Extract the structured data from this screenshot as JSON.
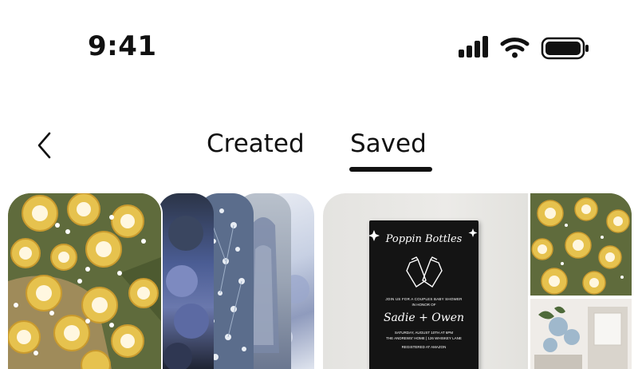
{
  "status_bar": {
    "time": "9:41",
    "icons": [
      "cellular-signal-icon",
      "wifi-icon",
      "battery-icon"
    ]
  },
  "nav": {
    "back_icon": "chevron-left-icon",
    "tabs": [
      {
        "label": "Created",
        "active": false
      },
      {
        "label": "Saved",
        "active": true
      }
    ]
  },
  "boards": [
    {
      "name": "board-collage-left",
      "images": [
        "lemon-gypsophila-photo",
        "blue-flowers-photo",
        "babys-breath-photo",
        "blue-vase-photo",
        "light-blue-decor-photo"
      ]
    },
    {
      "name": "board-collage-right",
      "images": [
        "invitation-card-photo",
        "lemon-gypsophila-photo",
        "baby-shower-decor-photo"
      ],
      "invitation": {
        "title": "Poppin Bottles",
        "line1": "JOIN US FOR A COUPLES BABY SHOWER",
        "line2": "IN HONOR OF",
        "names": "Sadie + Owen",
        "line3": "SATURDAY, AUGUST 10TH AT 6PM",
        "line4": "THE ANDREWS' HOME | 126 WHISKEY LANE",
        "line5": "REGISTERED AT AMAZON"
      }
    }
  ],
  "colors": {
    "lemon": "#e6c24e",
    "leaf": "#5f6b3c",
    "blue": "#4b5d94",
    "card": "#111111",
    "text": "#111111"
  }
}
